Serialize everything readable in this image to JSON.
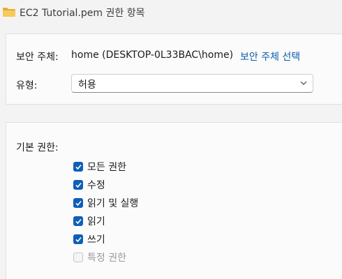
{
  "window": {
    "title": "EC2 Tutorial.pem 권한 항목",
    "title_icon": "folder-icon"
  },
  "principal": {
    "label": "보안 주체:",
    "value": "home (DESKTOP-0L33BAC\\home)",
    "select_link": "보안 주체 선택"
  },
  "type": {
    "label": "유형:",
    "selected": "허용"
  },
  "permissions": {
    "label": "기본 권한:",
    "items": [
      {
        "label": "모든 권한",
        "checked": true,
        "enabled": true
      },
      {
        "label": "수정",
        "checked": true,
        "enabled": true
      },
      {
        "label": "읽기 및 실행",
        "checked": true,
        "enabled": true
      },
      {
        "label": "읽기",
        "checked": true,
        "enabled": true
      },
      {
        "label": "쓰기",
        "checked": true,
        "enabled": true
      },
      {
        "label": "특정 권한",
        "checked": false,
        "enabled": false
      }
    ]
  },
  "colors": {
    "accent": "#0f5fb8",
    "link": "#0b5cad",
    "folder": "#f2c14e"
  }
}
